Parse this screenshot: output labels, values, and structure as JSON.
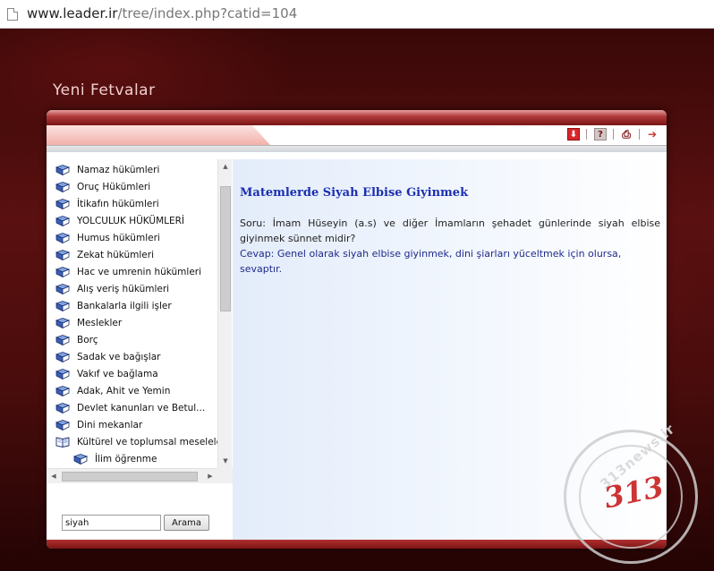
{
  "browser": {
    "url_host": "www.leader.ir",
    "url_path": "/tree/index.php?catid=104"
  },
  "site": {
    "title": "Yeni Fetvalar"
  },
  "toolbar": {
    "download_icon": "download-icon",
    "help_icon": "help-icon",
    "print_icon": "print-icon",
    "next_icon": "next-arrow-icon",
    "help_glyph": "?",
    "download_glyph": "⬇",
    "print_glyph": "⎙",
    "next_glyph": "➔"
  },
  "tree": {
    "items": [
      {
        "label": "Namaz hükümleri",
        "open": false,
        "level": 0
      },
      {
        "label": "Oruç Hükümleri",
        "open": false,
        "level": 0
      },
      {
        "label": "İtikafın hükümleri",
        "open": false,
        "level": 0
      },
      {
        "label": "YOLCULUK HÜKÜMLERİ",
        "open": false,
        "level": 0
      },
      {
        "label": "Humus hükümleri",
        "open": false,
        "level": 0
      },
      {
        "label": "Zekat hükümleri",
        "open": false,
        "level": 0
      },
      {
        "label": "Hac ve umrenin hükümleri",
        "open": false,
        "level": 0
      },
      {
        "label": "Alış veriş hükümleri",
        "open": false,
        "level": 0
      },
      {
        "label": "Bankalarla ilgili işler",
        "open": false,
        "level": 0
      },
      {
        "label": "Meslekler",
        "open": false,
        "level": 0
      },
      {
        "label": "Borç",
        "open": false,
        "level": 0
      },
      {
        "label": "Sadak ve bağışlar",
        "open": false,
        "level": 0
      },
      {
        "label": "Vakıf ve bağlama",
        "open": false,
        "level": 0
      },
      {
        "label": "Adak, Ahit ve Yemin",
        "open": false,
        "level": 0
      },
      {
        "label": "Devlet kanunları ve Betul...",
        "open": false,
        "level": 0
      },
      {
        "label": "Dini mekanlar",
        "open": false,
        "level": 0
      },
      {
        "label": "Kültürel ve toplumsal meseleler",
        "open": true,
        "level": 0
      },
      {
        "label": "İlim öğrenme",
        "open": false,
        "level": 1
      }
    ]
  },
  "search": {
    "value": "siyah",
    "button_label": "Arama"
  },
  "article": {
    "title": "Matemlerde Siyah Elbise Giyinmek",
    "question": "Soru: İmam Hüseyin (a.s) ve diğer İmamların şehadet günlerinde siyah elbise giyinmek sünnet midir?",
    "answer": "Cevap: Genel olarak siyah elbise giyinmek, dini şiarları yüceltmek için olursa, sevaptır."
  },
  "watermark": {
    "number": "313",
    "text": "313news.ir"
  },
  "colors": {
    "title_blue": "#1a2fb0",
    "answer_blue": "#1f2a8a",
    "frame_red": "#7a1414"
  }
}
